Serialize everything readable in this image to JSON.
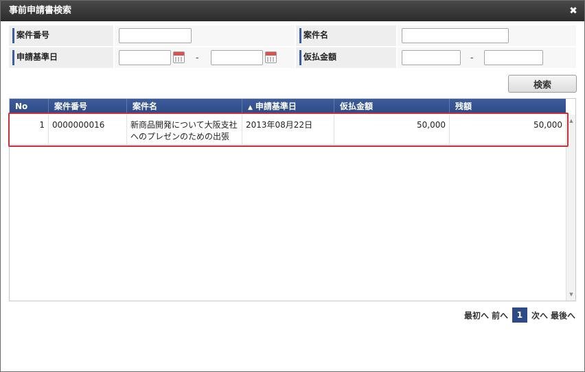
{
  "dialog": {
    "title": "事前申請書検索",
    "close_glyph": "✖"
  },
  "form": {
    "case_number": {
      "label": "案件番号",
      "value": ""
    },
    "case_name": {
      "label": "案件名",
      "value": ""
    },
    "application_date": {
      "label": "申請基準日",
      "from": "",
      "to": "",
      "separator": "-"
    },
    "advance_amount": {
      "label": "仮払金額",
      "from": "",
      "to": "",
      "separator": "-"
    }
  },
  "search_button": {
    "label": "検索"
  },
  "table": {
    "columns": {
      "no": "No",
      "case_number": "案件番号",
      "case_name": "案件名",
      "application_date": "申請基準日",
      "advance_amount": "仮払金額",
      "balance": "残額"
    },
    "sort_indicator": "▲",
    "rows": [
      {
        "no": "1",
        "case_number": "0000000016",
        "case_name": "新商品開発について大阪支社へのプレゼンのための出張",
        "application_date": "2013年08月22日",
        "advance_amount": "50,000",
        "balance": "50,000"
      }
    ]
  },
  "scrollbar": {
    "up": "▲",
    "down": "▼"
  },
  "pager": {
    "first": "最初へ",
    "prev": "前へ",
    "current": "1",
    "next": "次へ",
    "last": "最後へ"
  },
  "colors": {
    "header": "#2c4a86",
    "highlight": "#c9303a",
    "titlebar": "#333333"
  }
}
